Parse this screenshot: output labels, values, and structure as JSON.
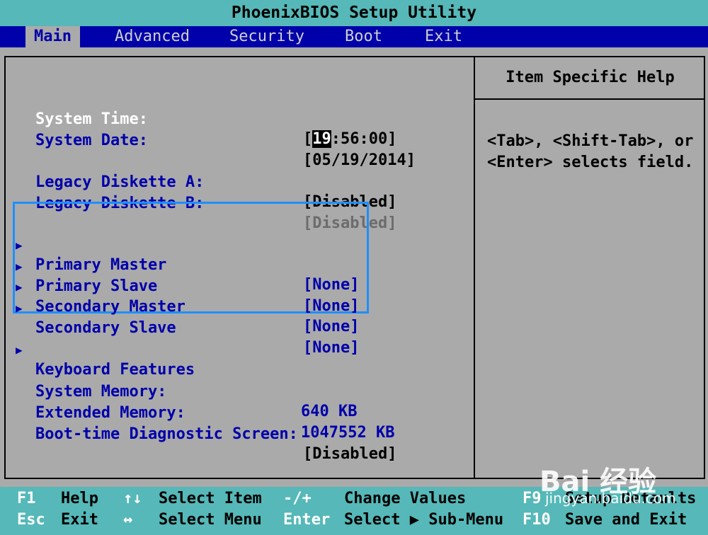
{
  "title": "PhoenixBIOS Setup Utility",
  "menu": [
    {
      "label": "Main",
      "active": true
    },
    {
      "label": "Advanced"
    },
    {
      "label": "Security"
    },
    {
      "label": "Boot"
    },
    {
      "label": "Exit"
    }
  ],
  "fields": {
    "system_time": {
      "label": "System Time:",
      "value_open": "[",
      "value_hl": "19",
      "value_rest": ":56:00]"
    },
    "system_date": {
      "label": "System Date:",
      "value": "[05/19/2014]"
    },
    "legacy_a": {
      "label": "Legacy Diskette A:",
      "value": "[Disabled]"
    },
    "legacy_b": {
      "label": "Legacy Diskette B:",
      "value": "[Disabled]"
    },
    "primary_master": {
      "label": "Primary Master",
      "value": "[None]"
    },
    "primary_slave": {
      "label": "Primary Slave",
      "value": "[None]"
    },
    "secondary_master": {
      "label": "Secondary Master",
      "value": "[None]"
    },
    "secondary_slave": {
      "label": "Secondary Slave",
      "value": "[None]"
    },
    "keyboard_features": {
      "label": "Keyboard Features"
    },
    "system_memory": {
      "label": "System Memory:",
      "value": "640 KB"
    },
    "extended_memory": {
      "label": "Extended Memory:",
      "value": "1047552 KB"
    },
    "boot_diag": {
      "label": "Boot-time Diagnostic Screen:",
      "value": "[Disabled]"
    }
  },
  "help": {
    "title": "Item Specific Help",
    "text_line1": "<Tab>, <Shift-Tab>, or",
    "text_line2": "<Enter> selects field."
  },
  "footer": {
    "f1_key": "F1",
    "f1_desc": "Help",
    "updown_key": "↑↓",
    "updown_desc": "Select Item",
    "minusplus_key": "-/+",
    "minusplus_desc": "Change Values",
    "f9_key": "F9",
    "f9_desc": "Setup Defaults",
    "esc_key": "Esc",
    "esc_desc": "Exit",
    "leftright_key": "↔",
    "leftright_desc": "Select Menu",
    "enter_key": "Enter",
    "enter_desc": "Select ▶ Sub-Menu",
    "f10_key": "F10",
    "f10_desc": "Save and Exit"
  },
  "watermark": {
    "logo": "Bai 经验",
    "url": "jingyan.baidu.com"
  },
  "colors": {
    "menu_bg": "#0000aa",
    "panel_bg": "#aaaaaa",
    "title_bg": "#56b8b8",
    "highlight_border": "#1e8fff"
  }
}
